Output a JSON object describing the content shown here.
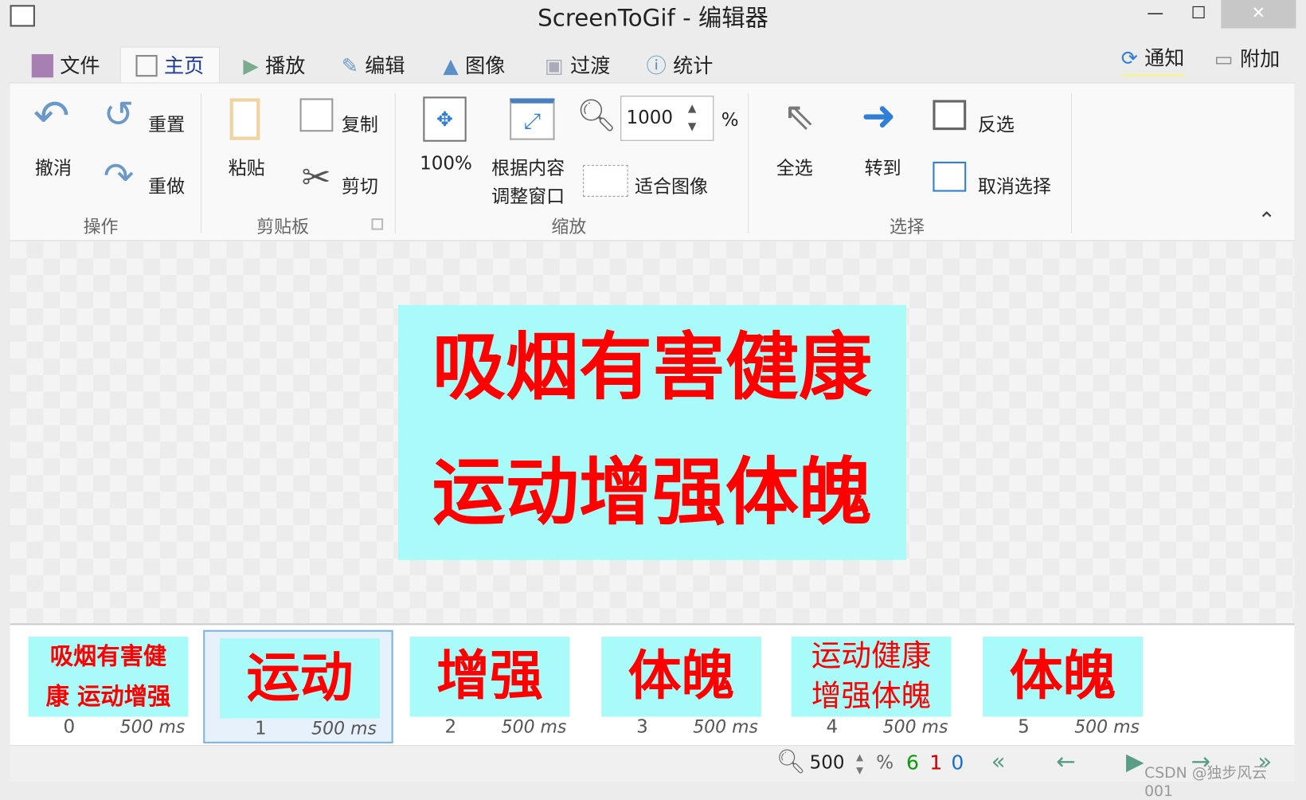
{
  "window": {
    "title": "ScreenToGif - 编辑器",
    "minimize": "—",
    "maximize": "☐",
    "close": "✕"
  },
  "tabs": [
    {
      "label": "文件"
    },
    {
      "label": "主页"
    },
    {
      "label": "播放"
    },
    {
      "label": "编辑"
    },
    {
      "label": "图像"
    },
    {
      "label": "过渡"
    },
    {
      "label": "统计"
    }
  ],
  "top_right": {
    "notify": "通知",
    "extras": "附加"
  },
  "ribbon": {
    "actions": {
      "group": "操作",
      "undo": "撤消",
      "reset": "重置",
      "redo": "重做"
    },
    "clipboard": {
      "group": "剪贴板",
      "paste": "粘贴",
      "copy": "复制",
      "cut": "剪切"
    },
    "zoom": {
      "group": "缩放",
      "zoom100": "100%",
      "fit_window_1": "根据内容",
      "fit_window_2": "调整窗口",
      "zoom_value": "1000",
      "percent": "%",
      "fit_image": "适合图像"
    },
    "select": {
      "group": "选择",
      "select_all": "全选",
      "goto": "转到",
      "invert": "反选",
      "deselect": "取消选择"
    }
  },
  "canvas": {
    "line1": "吸烟有害健康",
    "line2": "运动增强体魄",
    "background": "#a8fbf8",
    "text_color": "#ff0000"
  },
  "frames": [
    {
      "index": "0",
      "duration": "500 ms",
      "text": "吸烟有害健康 运动增强体魄"
    },
    {
      "index": "1",
      "duration": "500 ms",
      "text": "运动",
      "selected": true
    },
    {
      "index": "2",
      "duration": "500 ms",
      "text": "增强"
    },
    {
      "index": "3",
      "duration": "500 ms",
      "text": "体魄"
    },
    {
      "index": "4",
      "duration": "500 ms",
      "text": "运动健康 增强体魄"
    },
    {
      "index": "5",
      "duration": "500 ms",
      "text": "体魄"
    }
  ],
  "status": {
    "zoom": "500",
    "percent": "%",
    "frame_count": "6",
    "selected_count": "1",
    "current_frame": "0",
    "watermark": "CSDN @独步风云001"
  }
}
